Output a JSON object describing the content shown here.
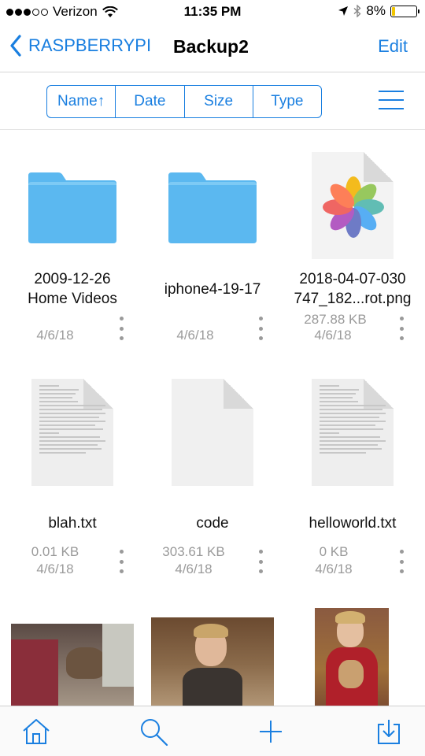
{
  "status_bar": {
    "carrier": "Verizon",
    "time": "11:35 PM",
    "battery": "8%",
    "battery_level": 0.08,
    "signal_bars_filled": 3,
    "signal_bars_total": 5
  },
  "nav": {
    "back_label": "RASPBERRYPI",
    "title": "Backup2",
    "edit_label": "Edit"
  },
  "sort": {
    "options": [
      "Name↑",
      "Date",
      "Size",
      "Type"
    ],
    "selected": "Name"
  },
  "files": [
    {
      "name": "2009-12-26\nHome Videos",
      "size": "",
      "date": "4/6/18",
      "kind": "folder"
    },
    {
      "name": "iphone4-19-17",
      "size": "",
      "date": "4/6/18",
      "kind": "folder"
    },
    {
      "name": "2018-04-07-030\n747_182...rot.png",
      "size": "287.88 KB",
      "date": "4/6/18",
      "kind": "photos-icon"
    },
    {
      "name": "blah.txt",
      "size": "0.01 KB",
      "date": "4/6/18",
      "kind": "text-doc"
    },
    {
      "name": "code",
      "size": "303.61 KB",
      "date": "4/6/18",
      "kind": "blank-doc"
    },
    {
      "name": "helloworld.txt",
      "size": "0 KB",
      "date": "4/6/18",
      "kind": "text-doc"
    }
  ],
  "photos": [
    {
      "kind": "photo-dog-bed"
    },
    {
      "kind": "photo-person-dog"
    },
    {
      "kind": "photo-person-holding-dog"
    }
  ],
  "tab_bar": {
    "icons": [
      "home-icon",
      "search-icon",
      "add-icon",
      "download-icon"
    ]
  },
  "colors": {
    "accent": "#1a7fe0",
    "folder": "#5bb8f0",
    "secondary_text": "#9a9a9a",
    "battery_fill": "#f2c600"
  }
}
